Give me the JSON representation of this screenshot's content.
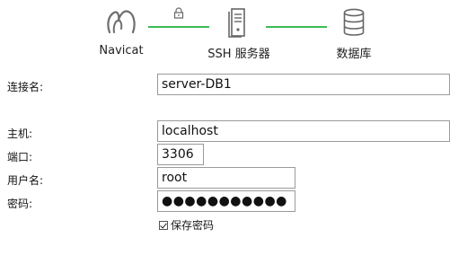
{
  "diagram": {
    "nodes": [
      {
        "label": "Navicat",
        "icon": "navicat-logo-icon"
      },
      {
        "label": "SSH 服务器",
        "icon": "server-icon"
      },
      {
        "label": "数据库",
        "icon": "database-icon"
      }
    ],
    "links": [
      {
        "icon": "lock-icon",
        "color": "#3dbb52"
      },
      {
        "icon": "",
        "color": "#3dbb52"
      }
    ]
  },
  "form": {
    "connection_name": {
      "label": "连接名:",
      "value": "server-DB1"
    },
    "host": {
      "label": "主机:",
      "value": "localhost"
    },
    "port": {
      "label": "端口:",
      "value": "3306"
    },
    "username": {
      "label": "用户名:",
      "value": "root"
    },
    "password": {
      "label": "密码:",
      "value": "●●●●●●●●●●●"
    },
    "save_password": {
      "label": "保存密码",
      "checked": true
    }
  }
}
